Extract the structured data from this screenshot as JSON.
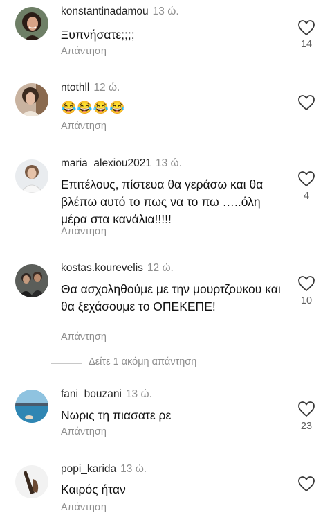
{
  "comments": [
    {
      "username": "konstantinadamou",
      "time": "13 ώ.",
      "text": "Ξυπνήσατε;;;;",
      "reply": "Απάντηση",
      "likes": "14",
      "avatar_icon": "avatar-woman-dark-hair"
    },
    {
      "username": "ntothll",
      "time": "12 ώ.",
      "text": "😂😂😂😂",
      "reply": "Απάντηση",
      "likes": "",
      "avatar_icon": "avatar-woman-glasses"
    },
    {
      "username": "maria_alexiou2021",
      "time": "13 ώ.",
      "text": "Επιτέλους, πίστευα θα γεράσω και θα βλέπω αυτό το πως να το πω …..όλη μέρα στα κανάλια!!!!!",
      "reply": "Απάντηση",
      "likes": "4",
      "avatar_icon": "avatar-woman-light"
    },
    {
      "username": "kostas.kourevelis",
      "time": "12 ώ.",
      "text": "Θα ασχοληθούμε με την μουρτζουκου και θα ξεχάσουμε το ΟΠΕΚΕΠΕ!",
      "reply": "Απάντηση",
      "likes": "10",
      "avatar_icon": "avatar-group-photo"
    },
    {
      "username": "fani_bouzani",
      "time": "13 ώ.",
      "text": "Νωρις τη πιασατε ρε",
      "reply": "Απάντηση",
      "likes": "23",
      "avatar_icon": "avatar-sea-landscape"
    },
    {
      "username": "popi_karida",
      "time": "13 ώ.",
      "text": "Καιρός ήταν",
      "reply": "Απάντηση",
      "likes": "",
      "avatar_icon": "avatar-dark-object"
    }
  ],
  "more_replies": "Δείτε 1 ακόμη απάντηση",
  "colors": {
    "muted": "#8e8e8e",
    "text": "#111111",
    "background": "#ffffff"
  }
}
